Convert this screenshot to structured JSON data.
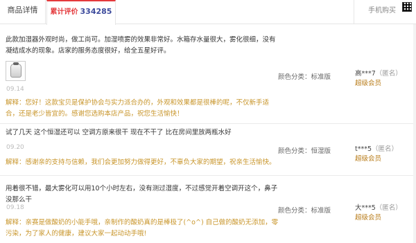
{
  "tabs": {
    "details_label": "商品详情",
    "reviews_label": "累计评价",
    "reviews_count": "334285",
    "mobile_buy_label": "手机购买"
  },
  "reviews": [
    {
      "content_lines": [
        "此款加湿器外观时尚，做工尚可。加湿喷雾的效果非常好。水箱存水量很大，雾化很细，没有",
        "凝结成水的现象。店家的服务态度很好，给全五星好评。"
      ],
      "date": "09.14",
      "reply_lines": [
        "解释：您好！这款宝贝是保护协会与实力派合办的，外观和效果都是很棒的呢，不仅新手适",
        "合，还是老少皆宜的。感谢您选购本店产品，祝您生活愉快！"
      ],
      "color": "颜色分类：标准版",
      "user": "高***7",
      "anon": "（匿名）",
      "level": "超级会员",
      "has_photo": true
    },
    {
      "content_lines": [
        "试了几天 这个恒湿还可以 空调方原来很干 现在不干了 比在房间里放两瓶水好"
      ],
      "date": "09.20",
      "reply_lines": [
        "解释：感谢亲的支持与信赖，我们会更加努力做得更好，不辜负大家的期望，祝亲生活愉快。"
      ],
      "color": "颜色分类：恒湿版",
      "user": "t***5",
      "anon": "（匿名）",
      "level": "超级会员",
      "has_photo": false
    },
    {
      "content_lines": [
        "用着很不错，最大雾化可以用10个小时左右，没有测过湿度，不过感觉开着空调开这个，鼻子",
        "没那么干"
      ],
      "date": "09.18",
      "reply_lines": [
        "解释：亲赛是做酸奶的小能手哦，亲制作的酸奶真的是棒极了(^o^) 自己做的酸奶无添加，零",
        "污染，为了家人的健康，建议大家一起动动手哦!"
      ],
      "color": "颜色分类：标准版",
      "user": "大***5",
      "anon": "（匿名）",
      "level": "超级会员",
      "has_photo": false
    }
  ]
}
